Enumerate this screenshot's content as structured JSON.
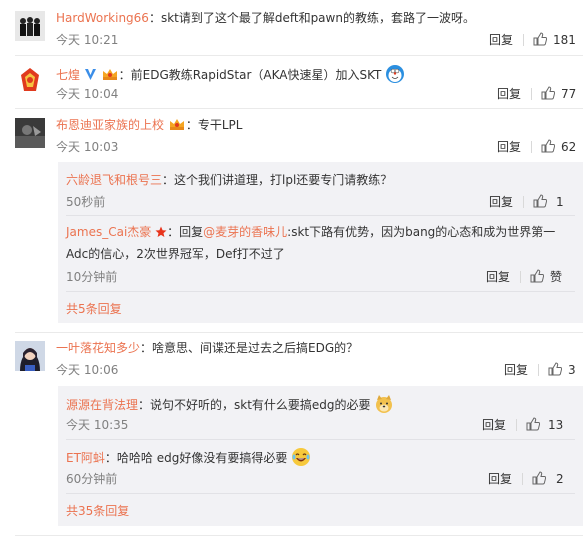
{
  "comments": [
    {
      "username": "HardWorking66",
      "text": "：skt请到了这个最了解deft和pawn的教练，套路了一波呀。",
      "time": "今天 10:21",
      "reply_label": "回复",
      "likes": "181"
    },
    {
      "username": "七煌",
      "text": "：前EDG教练RapidStar（AKA快速星）加入SKT",
      "time": "今天 10:04",
      "reply_label": "回复",
      "likes": "77"
    },
    {
      "username": "布恩迪亚家族的上校",
      "text": "：专干LPL",
      "time": "今天 10:03",
      "reply_label": "回复",
      "likes": "62",
      "replies": [
        {
          "username": "六龄退飞和根号三",
          "text": "：这个我们讲道理，打lpl还要专门请教练？",
          "time": "50秒前",
          "reply_label": "回复",
          "likes": "1"
        },
        {
          "username": "James_Cai杰豪",
          "text_prefix": "：回复",
          "mention": "@麦芽的香味儿",
          "text_line1": ":skt下路有优势，因为bang的心态和成为世界第一",
          "text_line2": "Adc的信心，2次世界冠军，Def打不过了",
          "time": "10分钟前",
          "reply_label": "回复",
          "like_label": "赞"
        }
      ],
      "more_replies": "共5条回复"
    },
    {
      "username": "一叶落花知多少",
      "text": "：啥意思、间谍还是过去之后搞EDG的？",
      "time": "今天 10:06",
      "reply_label": "回复",
      "likes": "3",
      "replies": [
        {
          "username": "源源在背法理",
          "text": "：说句不好听的，skt有什么要搞edg的必要",
          "time": "今天 10:35",
          "reply_label": "回复",
          "likes": "13"
        },
        {
          "username": "ET阿蚪",
          "text": "：哈哈哈 edg好像没有要搞得必要",
          "time": "60分钟前",
          "reply_label": "回复",
          "likes": "2"
        }
      ],
      "more_replies": "共35条回复"
    }
  ],
  "colors": {
    "username": "#eb7350",
    "text": "#333333",
    "time": "#808080",
    "reply_box": "#f2f2f5"
  }
}
